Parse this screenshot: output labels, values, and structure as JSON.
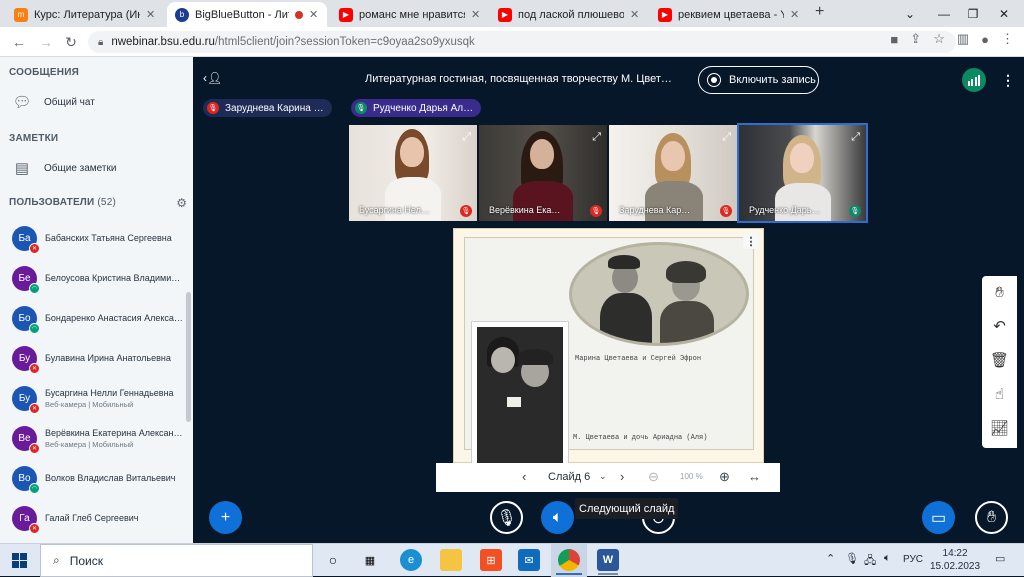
{
  "browser": {
    "tabs": [
      {
        "title": "Курс: Литература (Инжи",
        "icon": "moodle-icon",
        "active": false
      },
      {
        "title": "BigBlueButton - Лите",
        "icon": "bbb-icon",
        "active": true
      },
      {
        "title": "романс мне нравится чт",
        "icon": "youtube-icon",
        "active": false
      },
      {
        "title": "под лаской плюшевого",
        "icon": "youtube-icon",
        "active": false
      },
      {
        "title": "реквием цветаева - YouT",
        "icon": "youtube-icon",
        "active": false
      }
    ],
    "new_tab": "+",
    "url_host": "nwebinar.bsu.edu.ru",
    "url_path": "/html5client/join?sessionToken=c9oyaa2so9yxusqk"
  },
  "sidebar": {
    "messages_heading": "СООБЩЕНИЯ",
    "public_chat": "Общий чат",
    "notes_heading": "ЗАМЕТКИ",
    "shared_notes": "Общие заметки",
    "users_heading": "ПОЛЬЗОВАТЕЛИ",
    "users_count": "(52)",
    "users": [
      {
        "initials": "Ба",
        "name": "Бабанских Татьяна Сергеевна",
        "sub": "",
        "color": "#1b56b4",
        "status": "muted"
      },
      {
        "initials": "Бе",
        "name": "Белоусова Кристина Владими…",
        "sub": "",
        "color": "#6a1b9a",
        "status": "on"
      },
      {
        "initials": "Бо",
        "name": "Бондаренко Анастасия Алекса…",
        "sub": "",
        "color": "#1b56b4",
        "status": "on"
      },
      {
        "initials": "Бу",
        "name": "Булавина Ирина Анатольевна",
        "sub": "",
        "color": "#6a1b9a",
        "status": "muted"
      },
      {
        "initials": "Бу",
        "name": "Бусаргина Нелли Геннадьевна",
        "sub": "Веб-камера | Мобильный",
        "color": "#1b56b4",
        "status": "muted"
      },
      {
        "initials": "Ве",
        "name": "Верёвкина Екатерина Алексан…",
        "sub": "Веб-камера | Мобильный",
        "color": "#6a1b9a",
        "status": "muted"
      },
      {
        "initials": "Во",
        "name": "Волков Владислав Витальевич",
        "sub": "",
        "color": "#1b56b4",
        "status": "on"
      },
      {
        "initials": "Га",
        "name": "Галай Глеб Сергеевич",
        "sub": "",
        "color": "#6a1b9a",
        "status": "muted"
      }
    ]
  },
  "meeting": {
    "title": "Литературная гостиная, посвященная творчеству М. Цвет…",
    "record_label": "Включить запись",
    "talkers": [
      "Заруднева Карина …",
      "Рудченко Дарья Ал…"
    ],
    "videos": [
      {
        "name": "Бусаргина Нел…",
        "mic": "muted"
      },
      {
        "name": "Верёвкина Ека…",
        "mic": "muted"
      },
      {
        "name": "Заруднева Кар…",
        "mic": "muted"
      },
      {
        "name": "Рудченко Дарь…",
        "mic": "on"
      }
    ]
  },
  "slide": {
    "caption1": "Марина Цветаева и Сергей Эфрон",
    "caption2": "М. Цветаева и дочь Ариадна (Аля)",
    "label": "Слайд 6",
    "zoom": "100 %",
    "tooltip": "Следующий слайд"
  },
  "taskbar": {
    "search_label": "Поиск",
    "lang": "РУС",
    "time": "14:22",
    "date": "15.02.2023"
  }
}
